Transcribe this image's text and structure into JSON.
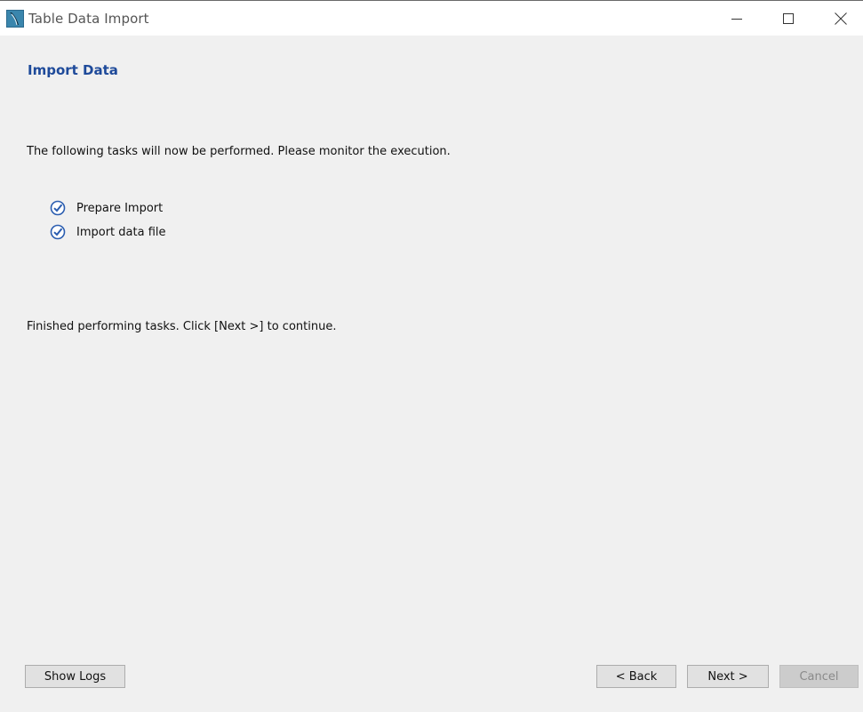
{
  "window": {
    "title": "Table Data Import",
    "app_icon": "mysql-workbench-icon",
    "controls": {
      "minimize_icon": "minimize-icon",
      "maximize_icon": "maximize-icon",
      "close_icon": "close-icon"
    }
  },
  "page": {
    "heading": "Import Data",
    "description": "The following tasks will now be performed. Please monitor the execution.",
    "tasks": [
      {
        "label": "Prepare Import",
        "icon": "check-circle-icon",
        "done": true
      },
      {
        "label": "Import data file",
        "icon": "check-circle-icon",
        "done": true
      }
    ],
    "status": "Finished performing tasks. Click [Next >] to continue."
  },
  "buttons": {
    "show_logs": "Show Logs",
    "back": "< Back",
    "next": "Next >",
    "cancel": "Cancel"
  },
  "colors": {
    "heading": "#1e4a9a",
    "check": "#2a5db0",
    "background": "#f0f0f0"
  }
}
